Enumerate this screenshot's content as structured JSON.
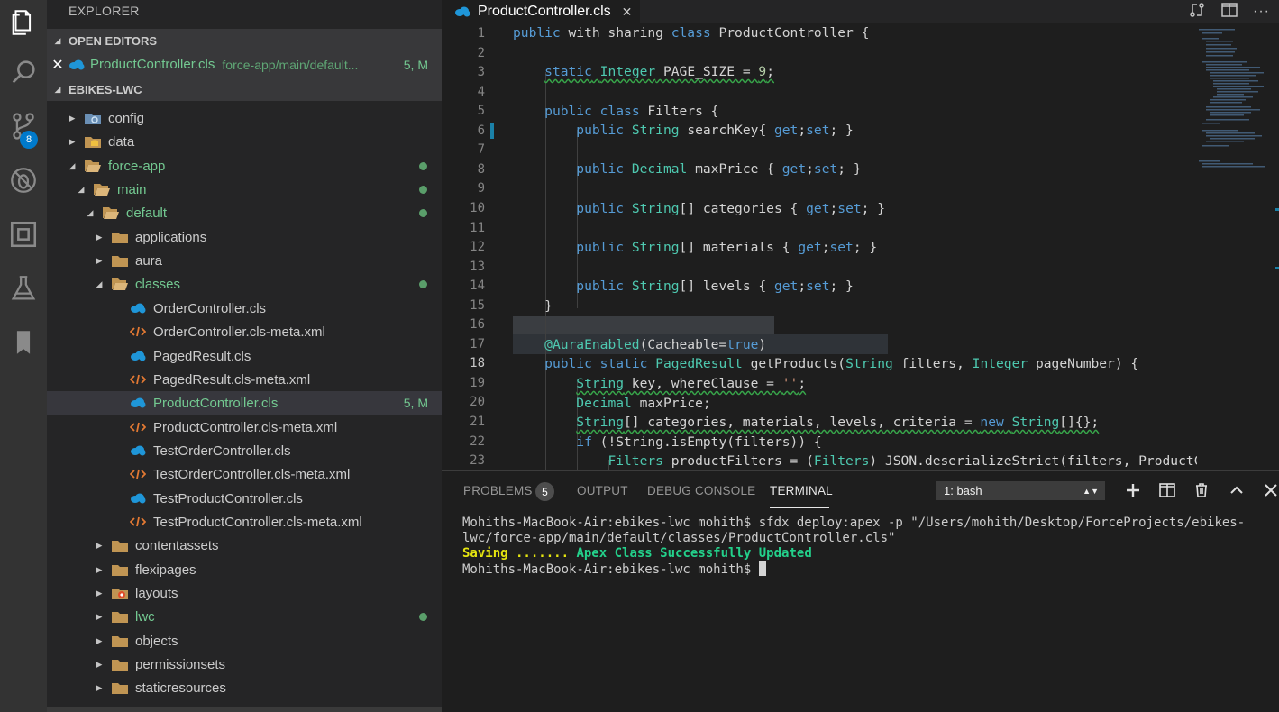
{
  "explorer_title": "EXPLORER",
  "open_editors": {
    "header": "OPEN EDITORS",
    "items": [
      {
        "name": "ProductController.cls",
        "path": "force-app/main/default...",
        "status": "5, M"
      }
    ]
  },
  "project": {
    "header": "EBIKES-LWC",
    "tree": [
      {
        "label": "config",
        "icon": "config-folder-icon"
      },
      {
        "label": "data",
        "icon": "data-folder-icon"
      },
      {
        "label": "force-app",
        "icon": "folder-open-icon"
      },
      {
        "label": "main",
        "icon": "folder-open-icon"
      },
      {
        "label": "default",
        "icon": "folder-open-icon"
      },
      {
        "label": "applications",
        "icon": "folder-icon"
      },
      {
        "label": "aura",
        "icon": "folder-icon"
      },
      {
        "label": "classes",
        "icon": "folder-open-icon"
      },
      {
        "label": "OrderController.cls",
        "icon": "apex-cloud-icon"
      },
      {
        "label": "OrderController.cls-meta.xml",
        "icon": "xml-icon"
      },
      {
        "label": "PagedResult.cls",
        "icon": "apex-cloud-icon"
      },
      {
        "label": "PagedResult.cls-meta.xml",
        "icon": "xml-icon"
      },
      {
        "label": "ProductController.cls",
        "icon": "apex-cloud-icon",
        "status": "5, M"
      },
      {
        "label": "ProductController.cls-meta.xml",
        "icon": "xml-icon"
      },
      {
        "label": "TestOrderController.cls",
        "icon": "apex-cloud-icon"
      },
      {
        "label": "TestOrderController.cls-meta.xml",
        "icon": "xml-icon"
      },
      {
        "label": "TestProductController.cls",
        "icon": "apex-cloud-icon"
      },
      {
        "label": "TestProductController.cls-meta.xml",
        "icon": "xml-icon"
      },
      {
        "label": "contentassets",
        "icon": "folder-icon"
      },
      {
        "label": "flexipages",
        "icon": "folder-icon"
      },
      {
        "label": "layouts",
        "icon": "layouts-folder-icon"
      },
      {
        "label": "lwc",
        "icon": "folder-icon"
      },
      {
        "label": "objects",
        "icon": "folder-icon"
      },
      {
        "label": "permissionsets",
        "icon": "folder-icon"
      },
      {
        "label": "staticresources",
        "icon": "folder-icon"
      }
    ]
  },
  "activity": {
    "scm_badge": "8"
  },
  "editor": {
    "tab_label": "ProductController.cls",
    "close_glyph": "✕",
    "line_numbers": [
      "1",
      "2",
      "3",
      "4",
      "5",
      "6",
      "7",
      "8",
      "9",
      "10",
      "11",
      "12",
      "13",
      "14",
      "15",
      "16",
      "17",
      "18",
      "19",
      "20",
      "21",
      "22",
      "23"
    ],
    "code": {
      "l1_a": "public",
      "l1_b": " with sharing ",
      "l1_c": "class",
      "l1_d": " ProductController {",
      "l3_a": "static",
      "l3_b": "Integer",
      "l3_c": " PAGE_SIZE = ",
      "l3_d": "9",
      "l3_e": ";",
      "l5_a": "public",
      "l5_b": "class",
      "l5_c": " Filters {",
      "l6_a": "public",
      "l6_b": "String",
      "l6_c": " searchKey{ ",
      "l6_d": "get",
      "l6_e": ";",
      "l6_f": "set",
      "l6_g": "; }",
      "l8_a": "public",
      "l8_b": "Decimal",
      "l8_c": " maxPrice { ",
      "l8_d": "get",
      "l8_e": ";",
      "l8_f": "set",
      "l8_g": "; }",
      "l10_a": "public",
      "l10_b": "String",
      "l10_c": "[] categories { ",
      "l10_d": "get",
      "l10_e": ";",
      "l10_f": "set",
      "l10_g": "; }",
      "l12_a": "public",
      "l12_b": "String",
      "l12_c": "[] materials { ",
      "l12_d": "get",
      "l12_e": ";",
      "l12_f": "set",
      "l12_g": "; }",
      "l14_a": "public",
      "l14_b": "String",
      "l14_c": "[] levels { ",
      "l14_d": "get",
      "l14_e": ";",
      "l14_f": "set",
      "l14_g": "; }",
      "l15": "}",
      "l17_a": "@AuraEnabled",
      "l17_b": "(Cacheable=",
      "l17_c": "true",
      "l17_d": ")",
      "l18_a": "public",
      "l18_b": "static",
      "l18_c": "PagedResult",
      "l18_d": " getProducts(",
      "l18_e": "String",
      "l18_f": " filters, ",
      "l18_g": "Integer",
      "l18_h": " pageNumber) {",
      "l19_a": "String",
      "l19_b": " key, whereClause = ",
      "l19_c": "''",
      "l19_d": ";",
      "l20_a": "Decimal",
      "l20_b": " maxPrice;",
      "l21_a": "String",
      "l21_b": "[] categories, materials, levels, criteria = ",
      "l21_c": "new",
      "l21_d": "String",
      "l21_e": "[]{};",
      "l22_a": "if",
      "l22_b": " (!String.isEmpty(filters)) {",
      "l23_a": "Filters",
      "l23_b": " productFilters = (",
      "l23_c": "Filters",
      "l23_d": ") JSON.deserializeStrict(filters, ProductCo"
    }
  },
  "panel": {
    "tabs": [
      "PROBLEMS",
      "OUTPUT",
      "DEBUG CONSOLE",
      "TERMINAL"
    ],
    "problems_count": "5",
    "terminal_select": "1: bash",
    "terminal": {
      "line1": "Mohiths-MacBook-Air:ebikes-lwc mohith$ sfdx deploy:apex -p \"/Users/mohith/Desktop/ForceProjects/ebikes-",
      "line2": "lwc/force-app/main/default/classes/ProductController.cls\"",
      "line3_saving": "Saving .......",
      "line3_result": "Apex Class Successfully Updated",
      "line4": "Mohiths-MacBook-Air:ebikes-lwc mohith$ "
    }
  },
  "colors": {
    "accent": "#007acc",
    "git_modified": "#73c991",
    "keyword": "#569cd6",
    "type": "#4ec9b0"
  }
}
